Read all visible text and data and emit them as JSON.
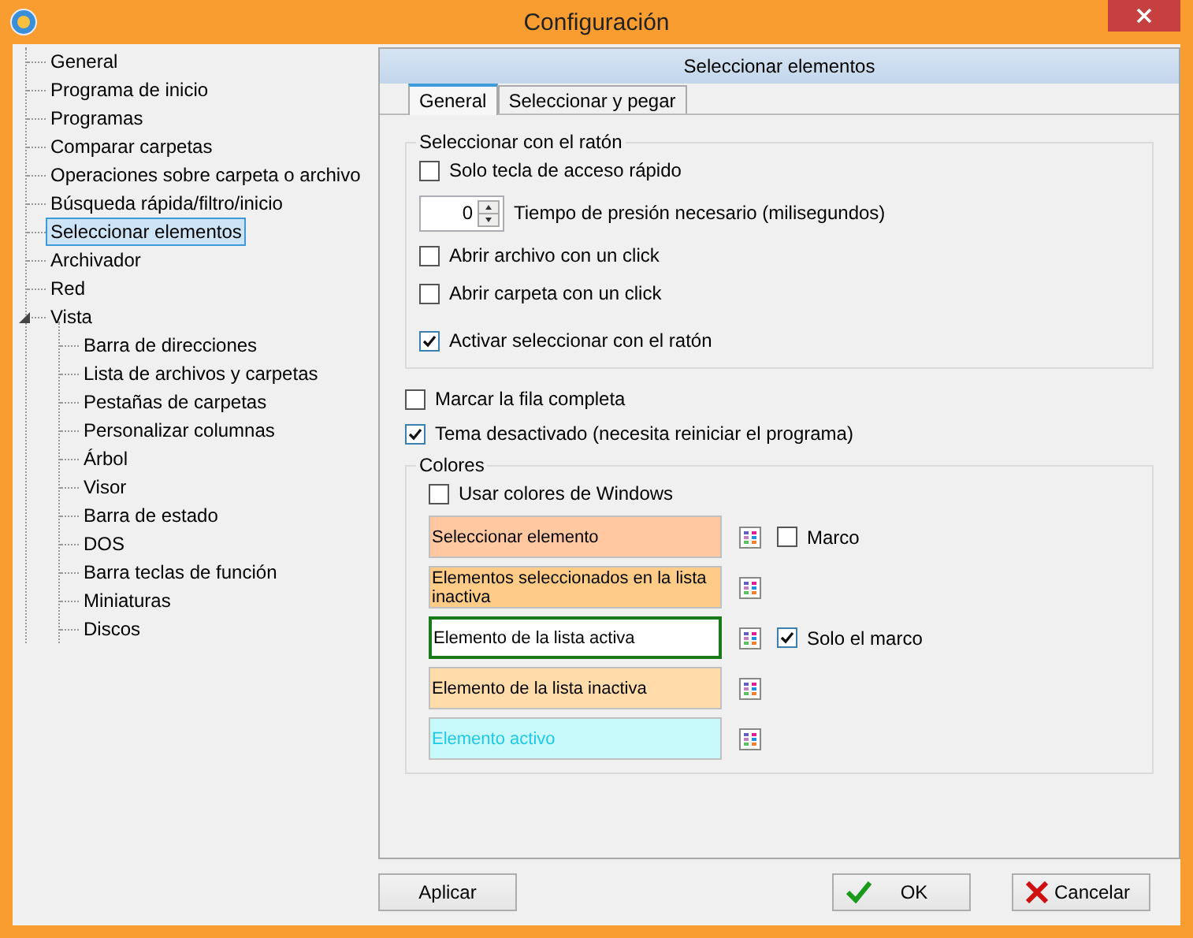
{
  "window": {
    "title": "Configuración"
  },
  "tree": [
    {
      "label": "General",
      "selected": false
    },
    {
      "label": "Programa de inicio",
      "selected": false
    },
    {
      "label": "Programas",
      "selected": false
    },
    {
      "label": "Comparar carpetas",
      "selected": false
    },
    {
      "label": "Operaciones sobre carpeta o archivo",
      "selected": false
    },
    {
      "label": "Búsqueda rápida/filtro/inicio",
      "selected": false
    },
    {
      "label": "Seleccionar elementos",
      "selected": true
    },
    {
      "label": "Archivador",
      "selected": false
    },
    {
      "label": "Red",
      "selected": false
    },
    {
      "label": "Vista",
      "selected": false,
      "expanded": true,
      "children": [
        {
          "label": "Barra de direcciones",
          "selected": false
        },
        {
          "label": "Lista de archivos y carpetas",
          "selected": false
        },
        {
          "label": "Pestañas de carpetas",
          "selected": false
        },
        {
          "label": "Personalizar columnas",
          "selected": false
        },
        {
          "label": "Árbol",
          "selected": false
        },
        {
          "label": "Visor",
          "selected": false
        },
        {
          "label": "Barra de estado",
          "selected": false
        },
        {
          "label": "DOS",
          "selected": false
        },
        {
          "label": "Barra teclas de función",
          "selected": false
        },
        {
          "label": "Miniaturas",
          "selected": false
        },
        {
          "label": "Discos",
          "selected": false
        }
      ]
    }
  ],
  "panel": {
    "title": "Seleccionar elementos",
    "tabs": [
      {
        "label": "General",
        "selected": true
      },
      {
        "label": "Seleccionar y pegar",
        "selected": false
      }
    ],
    "mouse_group": {
      "title": "Seleccionar con el ratón",
      "items": [
        {
          "kind": "checkbox",
          "label": "Solo tecla de acceso rápido",
          "checked": false
        },
        {
          "kind": "spinner",
          "value": "0",
          "label": "Tiempo de presión necesario (milisegundos)"
        },
        {
          "kind": "checkbox",
          "label": "Abrir archivo con un click",
          "checked": false
        },
        {
          "kind": "checkbox",
          "label": "Abrir carpeta con un click",
          "checked": false
        },
        {
          "kind": "checkbox",
          "label": "Activar seleccionar con el ratón",
          "checked": true
        }
      ]
    },
    "options": [
      {
        "label": "Marcar la fila completa",
        "checked": false
      },
      {
        "label": "Tema desactivado (necesita reiniciar el programa)",
        "checked": true
      }
    ],
    "colors_group": {
      "title": "Colores",
      "use_windows": {
        "label": "Usar colores de Windows",
        "checked": false
      },
      "rows": [
        {
          "kind": "fill",
          "label": "Seleccionar elemento",
          "color": "#ffc8a0",
          "option": {
            "label": "Marco",
            "checked": false
          }
        },
        {
          "kind": "fill",
          "label": "Elementos seleccionados en la lista inactiva",
          "color": "#ffcc88"
        },
        {
          "kind": "frame",
          "label": "Elemento de la lista activa",
          "color": "#1a7a1a",
          "option": {
            "label": "Solo el marco",
            "checked": true
          }
        },
        {
          "kind": "fill",
          "label": "Elemento de la lista inactiva",
          "color": "#ffdcaa"
        },
        {
          "kind": "text",
          "label": "Elemento activo",
          "color": "#20c8e8"
        }
      ]
    }
  },
  "buttons": [
    {
      "kind": "apply",
      "label": "Aplicar"
    },
    {
      "kind": "ok",
      "label": "OK"
    },
    {
      "kind": "cancel",
      "label": "Cancelar"
    }
  ]
}
